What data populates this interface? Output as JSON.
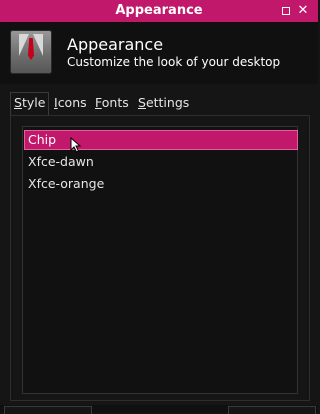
{
  "window": {
    "title": "Appearance",
    "maximize_icon": "maximize-icon",
    "close_glyph": "✕"
  },
  "header": {
    "icon": "appearance-suit-tie-icon",
    "title": "Appearance",
    "subtitle": "Customize the look of your desktop"
  },
  "tabs": [
    {
      "label": "Style",
      "active": true
    },
    {
      "label": "Icons",
      "active": false
    },
    {
      "label": "Fonts",
      "active": false
    },
    {
      "label": "Settings",
      "active": false
    }
  ],
  "themes": [
    {
      "label": "Chip",
      "selected": true
    },
    {
      "label": "Xfce-dawn",
      "selected": false
    },
    {
      "label": "Xfce-orange",
      "selected": false
    }
  ],
  "colors": {
    "accent": "#c2186b",
    "background": "#151515",
    "list_background": "#111111",
    "text": "#e6e6e6"
  }
}
